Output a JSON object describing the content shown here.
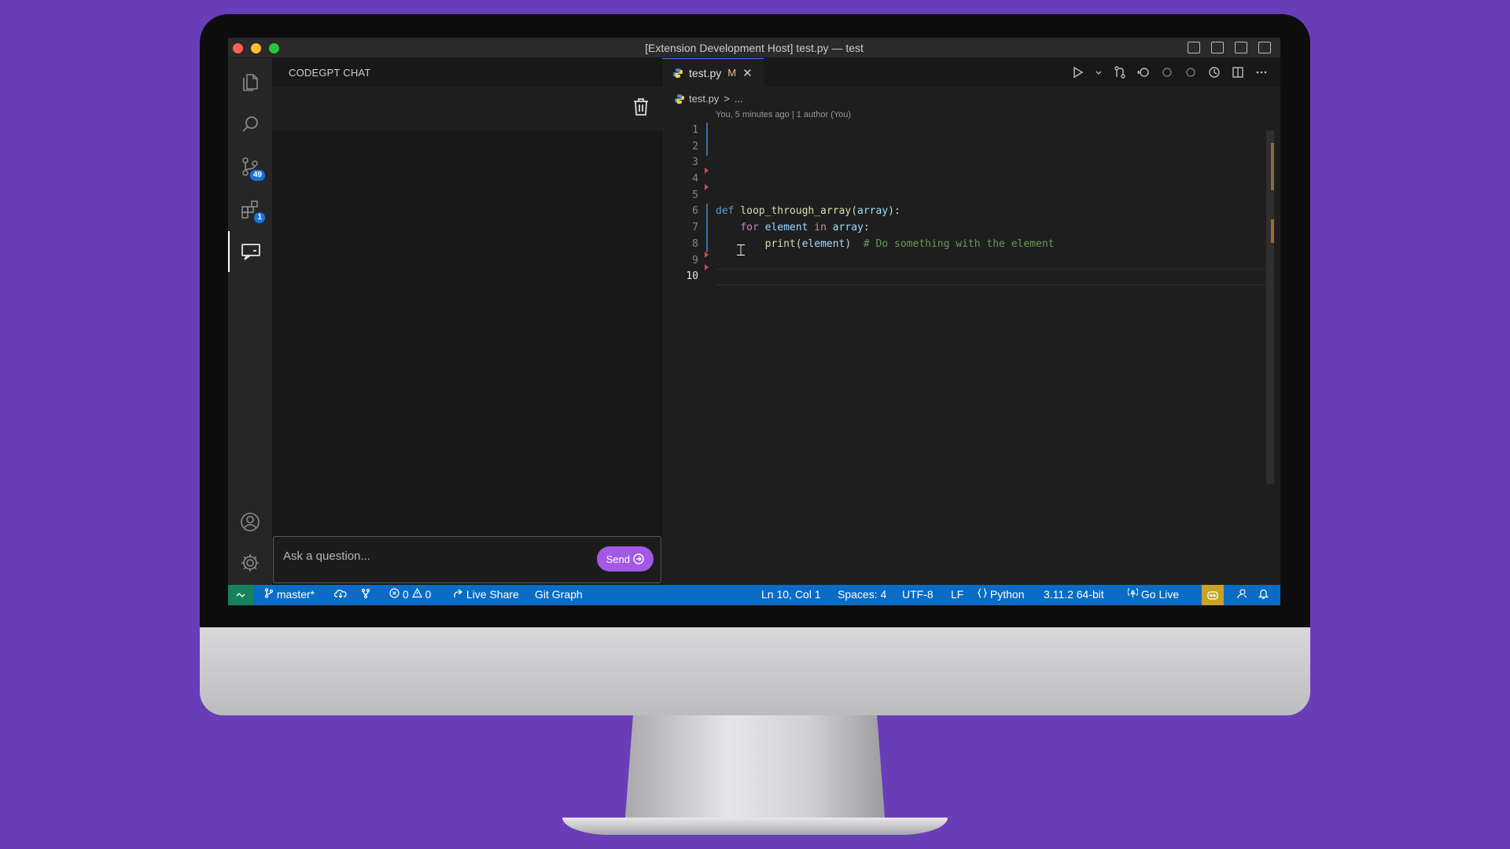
{
  "window": {
    "title": "[Extension Development Host] test.py — test"
  },
  "activity_bar": {
    "source_control_badge": "49",
    "extensions_badge": "1"
  },
  "chat_panel": {
    "title": "CODEGPT CHAT",
    "input_placeholder": "Ask a question...",
    "send_label": "Send"
  },
  "editor": {
    "tab": {
      "filename": "test.py",
      "modified_marker": "M",
      "close_glyph": "✕"
    },
    "breadcrumb": {
      "file": "test.py",
      "separator": ">",
      "more": "..."
    },
    "blame": "You, 5 minutes ago | 1 author (You)",
    "line_numbers": [
      "1",
      "2",
      "3",
      "4",
      "5",
      "6",
      "7",
      "8",
      "9",
      "10"
    ],
    "current_line": 10,
    "code": {
      "line6": {
        "kw": "def",
        "fn": "loop_through_array",
        "open": "(",
        "param": "array",
        "close": "):"
      },
      "line7": {
        "kw": "for",
        "var": "element",
        "in": "in",
        "iter": "array",
        "colon": ":"
      },
      "line8": {
        "fn": "print",
        "open": "(",
        "arg": "element",
        "close": ")",
        "comment": "# Do something with the element"
      }
    }
  },
  "status_bar": {
    "branch": "master*",
    "errors": "0",
    "warnings": "0",
    "live_share": "Live Share",
    "git_graph": "Git Graph",
    "cursor_position": "Ln 10, Col 1",
    "indentation": "Spaces: 4",
    "encoding": "UTF-8",
    "eol": "LF",
    "language": "Python",
    "interpreter": "3.11.2 64-bit",
    "go_live": "Go Live"
  },
  "colors": {
    "background": "#6a3db8",
    "status_bar": "#0a6cc4",
    "send_button": "#a259e6",
    "remote_indicator": "#16825d"
  }
}
